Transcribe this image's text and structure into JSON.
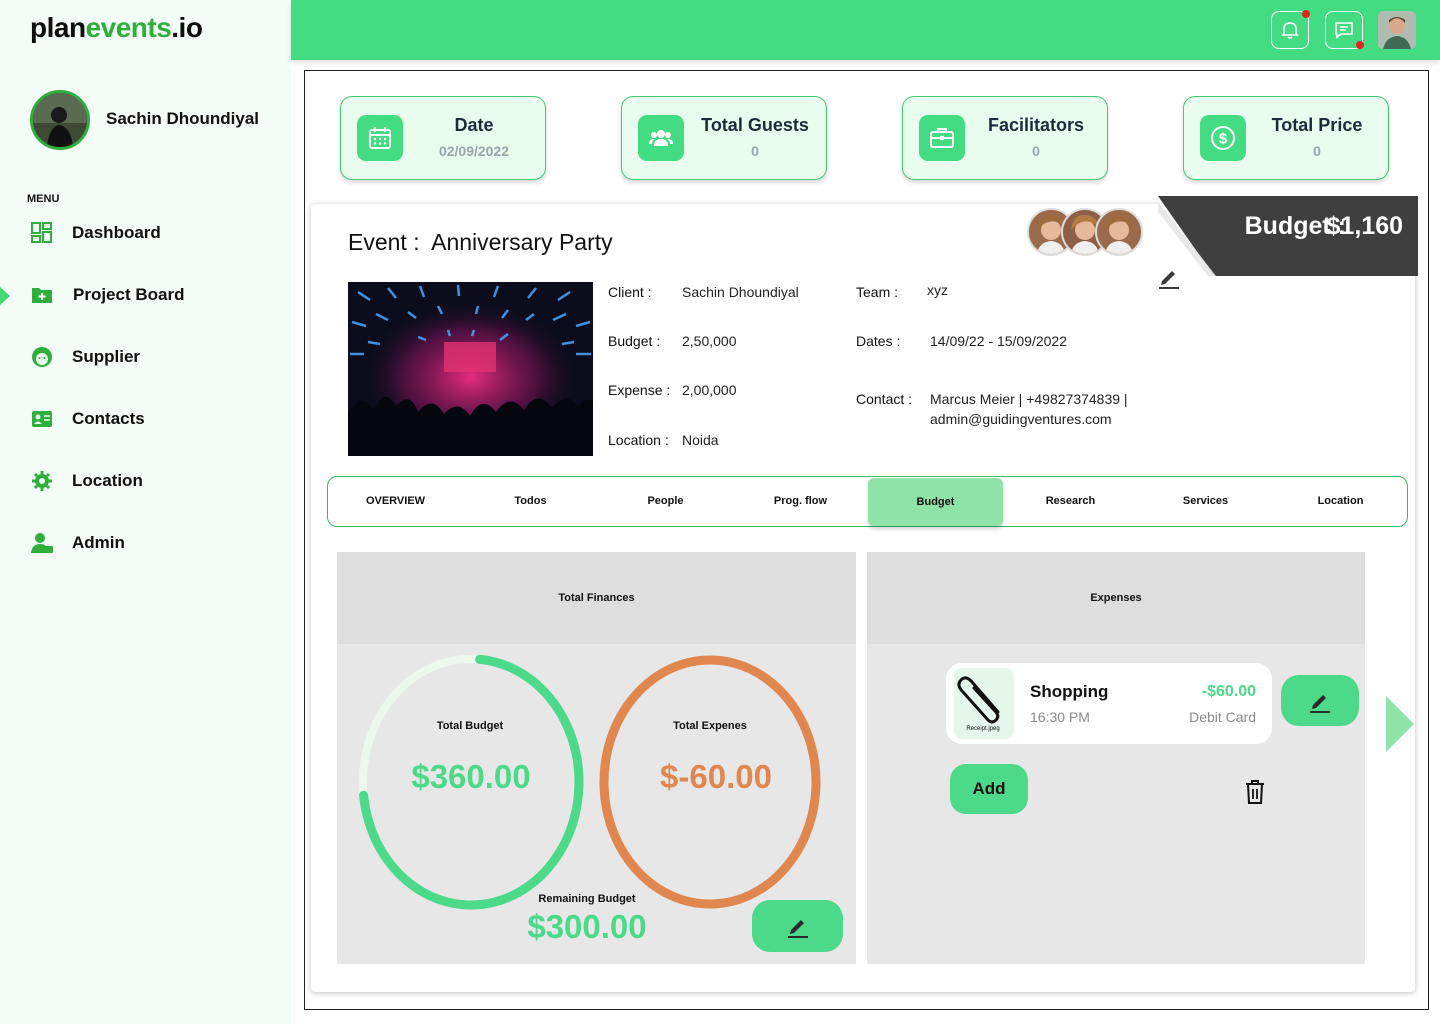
{
  "brand": {
    "name_part1": "plan",
    "name_part2": "events",
    "name_part3": ".io"
  },
  "user": {
    "name": "Sachin Dhoundiyal"
  },
  "sidebar": {
    "menu_label": "MENU",
    "items": [
      {
        "label": "Dashboard",
        "icon": "dashboard-icon"
      },
      {
        "label": "Project Board",
        "icon": "folder-add-icon",
        "active": true
      },
      {
        "label": "Supplier",
        "icon": "supplier-face-icon"
      },
      {
        "label": "Contacts",
        "icon": "contact-card-icon"
      },
      {
        "label": "Location",
        "icon": "gear-location-icon"
      },
      {
        "label": "Admin",
        "icon": "admin-user-icon"
      }
    ]
  },
  "topbar": {
    "icons": [
      "bell-icon",
      "chat-icon",
      "profile-avatar"
    ]
  },
  "stats": [
    {
      "title": "Date",
      "value": "02/09/2022",
      "icon": "calendar-icon"
    },
    {
      "title": "Total Guests",
      "value": "0",
      "icon": "guests-icon"
    },
    {
      "title": "Facilitators",
      "value": "0",
      "icon": "briefcase-icon"
    },
    {
      "title": "Total Price",
      "value": "0",
      "icon": "dollar-icon"
    }
  ],
  "budget_banner": {
    "label": "Budget :",
    "value": "$1,160"
  },
  "event": {
    "prefix": "Event :",
    "name": "Anniversary Party",
    "client_label": "Client :",
    "client": "Sachin Dhoundiyal",
    "budget_label": "Budget :",
    "budget": "2,50,000",
    "expense_label": "Expense :",
    "expense": "2,00,000",
    "location_label": "Location :",
    "location": "Noida",
    "team_label": "Team :",
    "team": "xyz",
    "dates_label": "Dates :",
    "dates": "14/09/22 - 15/09/2022",
    "contact_label": "Contact :",
    "contact_line1": "Marcus Meier | +49827374839 |",
    "contact_line2": "admin@guidingventures.com"
  },
  "tabs": [
    {
      "label": "OVERVIEW"
    },
    {
      "label": "Todos"
    },
    {
      "label": "People"
    },
    {
      "label": "Prog. flow"
    },
    {
      "label": "Budget",
      "active": true
    },
    {
      "label": "Research"
    },
    {
      "label": "Services"
    },
    {
      "label": "Location"
    }
  ],
  "finances": {
    "title": "Total Finances",
    "total_budget_label": "Total Budget",
    "total_budget_value": "$360.00",
    "total_expense_label": "Total Expenes",
    "total_expense_value": "$-60.00",
    "remaining_label": "Remaining Budget",
    "remaining_value": "$300.00",
    "budget_ring_fill": 0.72,
    "colors": {
      "green": "#4cd98a",
      "orange": "#e0874f"
    }
  },
  "expenses": {
    "title": "Expenses",
    "items": [
      {
        "name": "Shopping",
        "time": "16:30 PM",
        "amount": "-$60.00",
        "method": "Debit Card",
        "receipt": "Receipt.jpeg"
      }
    ],
    "add_label": "Add"
  }
}
